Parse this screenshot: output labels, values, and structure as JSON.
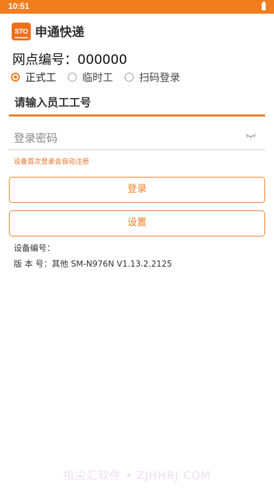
{
  "status_bar": {
    "time": "10:51"
  },
  "brand": {
    "logo_text": "STO",
    "name": "申通快递"
  },
  "station": {
    "label": "网点编号：",
    "value": "000000"
  },
  "work_type": {
    "options": [
      {
        "label": "正式工",
        "checked": true
      },
      {
        "label": "临时工",
        "checked": false
      },
      {
        "label": "扫码登录",
        "checked": false
      }
    ]
  },
  "login_form": {
    "employee_placeholder": "请输入员工工号",
    "password_placeholder": "登录密码",
    "hint": "设备首次登录会自动注册",
    "login_button": "登录",
    "settings_button": "设置"
  },
  "info": {
    "device_label": "设备编号：",
    "version_label": "版 本 号：",
    "version_value": "其他 SM-N976N V1.13.2.2125"
  },
  "watermark": "指尖汇软件 • ZJHHRJ.COM",
  "colors": {
    "accent": "#f07d1e",
    "hint": "#e8732b"
  }
}
